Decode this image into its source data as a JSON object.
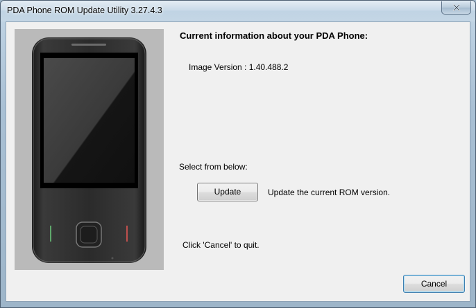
{
  "window": {
    "title": "PDA Phone ROM Update Utility 3.27.4.3"
  },
  "info": {
    "heading": "Current information about your PDA Phone:",
    "image_version": "Image Version : 1.40.488.2"
  },
  "actions": {
    "select_label": "Select from below:",
    "update_label": "Update",
    "update_description": "Update the current ROM version.",
    "quit_hint": "Click 'Cancel' to quit."
  },
  "footer": {
    "cancel_label": "Cancel"
  }
}
